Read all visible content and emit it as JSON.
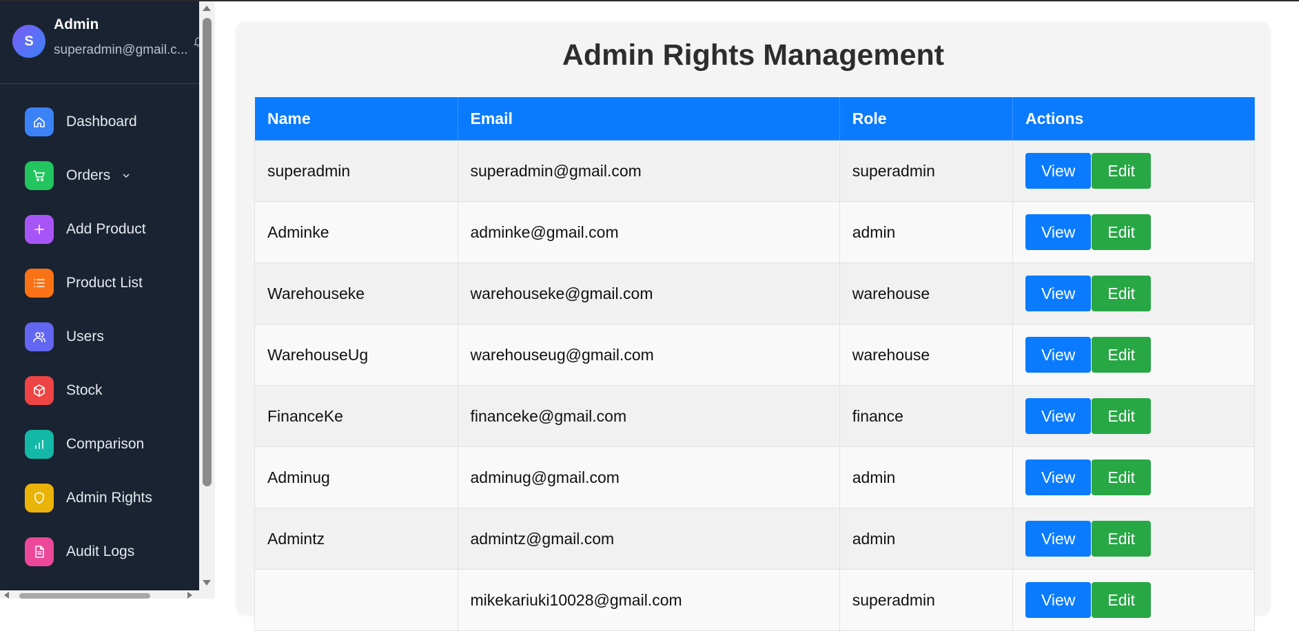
{
  "profile": {
    "avatar_initial": "S",
    "name": "Admin",
    "email": "superadmin@gmail.c..."
  },
  "nav": [
    {
      "label": "Dashboard",
      "icon": "home-icon",
      "color": "#3b82f6"
    },
    {
      "label": "Orders",
      "icon": "cart-icon",
      "color": "#22c55e",
      "has_chevron": true
    },
    {
      "label": "Add Product",
      "icon": "plus-icon",
      "color": "#a855f7"
    },
    {
      "label": "Product List",
      "icon": "list-icon",
      "color": "#f97316"
    },
    {
      "label": "Users",
      "icon": "users-icon",
      "color": "#6366f1"
    },
    {
      "label": "Stock",
      "icon": "box-icon",
      "color": "#ef4444"
    },
    {
      "label": "Comparison",
      "icon": "bar-chart-icon",
      "color": "#14b8a6"
    },
    {
      "label": "Admin Rights",
      "icon": "shield-icon",
      "color": "#eab308"
    },
    {
      "label": "Audit Logs",
      "icon": "document-icon",
      "color": "#ec4899"
    }
  ],
  "page": {
    "title": "Admin Rights Management"
  },
  "table": {
    "headers": [
      "Name",
      "Email",
      "Role",
      "Actions"
    ],
    "view_label": "View",
    "edit_label": "Edit",
    "rows": [
      {
        "name": "superadmin",
        "email": "superadmin@gmail.com",
        "role": "superadmin"
      },
      {
        "name": "Adminke",
        "email": "adminke@gmail.com",
        "role": "admin"
      },
      {
        "name": "Warehouseke",
        "email": "warehouseke@gmail.com",
        "role": "warehouse"
      },
      {
        "name": "WarehouseUg",
        "email": "warehouseug@gmail.com",
        "role": "warehouse"
      },
      {
        "name": "FinanceKe",
        "email": "financeke@gmail.com",
        "role": "finance"
      },
      {
        "name": "Adminug",
        "email": "adminug@gmail.com",
        "role": "admin"
      },
      {
        "name": "Admintz",
        "email": "admintz@gmail.com",
        "role": "admin"
      },
      {
        "name": "",
        "email": "mikekariuki10028@gmail.com",
        "role": "superadmin"
      }
    ]
  }
}
